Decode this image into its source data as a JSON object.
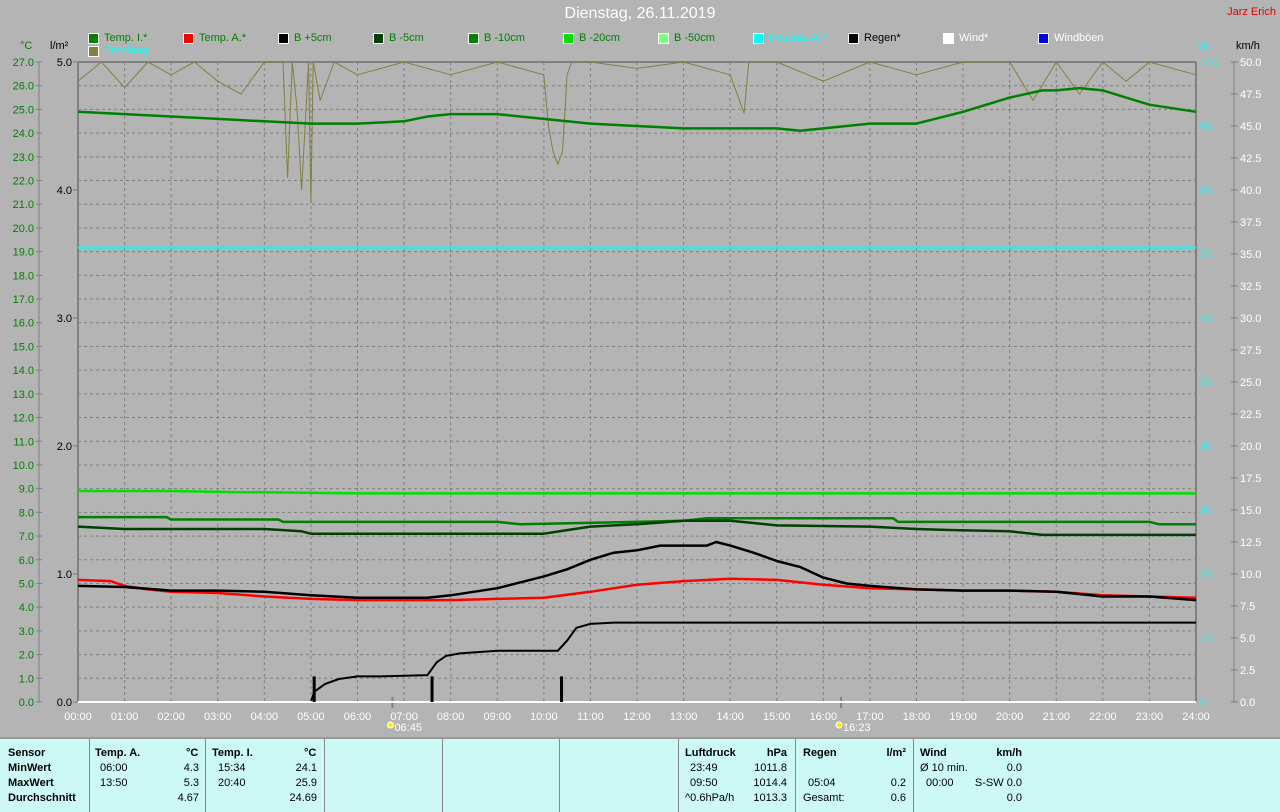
{
  "header": {
    "title": "Dienstag, 26.11.2019",
    "author": "Jarz Erich"
  },
  "legend": [
    {
      "label": "Temp. I.*",
      "color": "#008000",
      "text_color": "#008000"
    },
    {
      "label": "Temp. A.*",
      "color": "#ff0000",
      "text_color": "#008000"
    },
    {
      "label": "B +5cm",
      "color": "#000000",
      "text_color": "#008000"
    },
    {
      "label": "B -5cm",
      "color": "#004000",
      "text_color": "#008000"
    },
    {
      "label": "B -10cm",
      "color": "#008000",
      "text_color": "#008000"
    },
    {
      "label": "B -20cm",
      "color": "#00e000",
      "text_color": "#008000"
    },
    {
      "label": "B -50cm",
      "color": "#80ff80",
      "text_color": "#008000"
    },
    {
      "label": "Feuchte A.*",
      "color": "#00ffff",
      "text_color": "#00ffff"
    },
    {
      "label": "Regen*",
      "color": "#000000",
      "text_color": "#000000"
    },
    {
      "label": "Wind*",
      "color": "#ffffff",
      "text_color": "#ffffff"
    },
    {
      "label": "Windböen",
      "color": "#0000ff",
      "text_color": "#ffffff"
    },
    {
      "label": "Empfang",
      "color": "#808040",
      "text_color": "#00ffff"
    }
  ],
  "chart_data": {
    "type": "line",
    "title": "Dienstag, 26.11.2019",
    "x_unit": "hour",
    "xlim": [
      0,
      24
    ],
    "x_ticks": [
      "00:00",
      "01:00",
      "02:00",
      "03:00",
      "04:00",
      "05:00",
      "06:00",
      "07:00",
      "08:00",
      "09:00",
      "10:00",
      "11:00",
      "12:00",
      "13:00",
      "14:00",
      "15:00",
      "16:00",
      "17:00",
      "18:00",
      "19:00",
      "20:00",
      "21:00",
      "22:00",
      "23:00",
      "24:00"
    ],
    "axes": {
      "temp": {
        "label": "°C",
        "ylim": [
          0,
          27
        ],
        "ticks": [
          "0.0",
          "1.0",
          "2.0",
          "3.0",
          "4.0",
          "5.0",
          "6.0",
          "7.0",
          "8.0",
          "9.0",
          "10.0",
          "11.0",
          "12.0",
          "13.0",
          "14.0",
          "15.0",
          "16.0",
          "17.0",
          "18.0",
          "19.0",
          "20.0",
          "21.0",
          "22.0",
          "23.0",
          "24.0",
          "25.0",
          "26.0",
          "27.0"
        ]
      },
      "rain": {
        "label": "l/m²",
        "ylim": [
          0,
          5
        ],
        "ticks": [
          "0.0",
          "1.0",
          "2.0",
          "3.0",
          "4.0",
          "5.0"
        ]
      },
      "humidity": {
        "label": "%",
        "ylim": [
          0,
          100
        ],
        "ticks": [
          "0",
          "10",
          "20",
          "30",
          "40",
          "50",
          "60",
          "70",
          "80",
          "90",
          "100"
        ]
      },
      "wind": {
        "label": "km/h",
        "ylim": [
          0,
          50
        ],
        "ticks": [
          "0.0",
          "2.5",
          "5.0",
          "7.5",
          "10.0",
          "12.5",
          "15.0",
          "17.5",
          "20.0",
          "22.5",
          "25.0",
          "27.5",
          "30.0",
          "32.5",
          "35.0",
          "37.5",
          "40.0",
          "42.5",
          "45.0",
          "47.5",
          "50.0"
        ]
      }
    },
    "sun": {
      "sunrise": "06:45",
      "sunset": "16:23",
      "sunrise_h": 6.75,
      "sunset_h": 16.38
    },
    "series": [
      {
        "name": "Temp. I.",
        "axis": "temp",
        "color": "#008000",
        "x": [
          0,
          1,
          2,
          3,
          4,
          5,
          6,
          7,
          7.5,
          8,
          9,
          10,
          11,
          12,
          13,
          14,
          15,
          15.5,
          16,
          17,
          18,
          19,
          20,
          20.7,
          21,
          21.5,
          22,
          23,
          24
        ],
        "y": [
          24.9,
          24.8,
          24.7,
          24.6,
          24.5,
          24.4,
          24.4,
          24.5,
          24.7,
          24.8,
          24.8,
          24.6,
          24.4,
          24.3,
          24.2,
          24.2,
          24.2,
          24.1,
          24.2,
          24.4,
          24.4,
          24.9,
          25.5,
          25.8,
          25.8,
          25.9,
          25.8,
          25.2,
          24.9
        ]
      },
      {
        "name": "Temp. A.",
        "axis": "temp",
        "color": "#ff0000",
        "x": [
          0,
          0.7,
          1,
          1.5,
          2,
          3,
          4,
          5,
          6,
          7,
          8,
          9,
          10,
          11,
          12,
          13,
          14,
          15,
          16,
          17,
          18,
          19,
          20,
          21,
          22,
          23,
          24
        ],
        "y": [
          5.15,
          5.1,
          4.9,
          4.75,
          4.65,
          4.6,
          4.45,
          4.35,
          4.3,
          4.3,
          4.3,
          4.35,
          4.4,
          4.65,
          4.95,
          5.1,
          5.2,
          5.15,
          4.95,
          4.8,
          4.75,
          4.7,
          4.7,
          4.65,
          4.5,
          4.45,
          4.4
        ]
      },
      {
        "name": "B +5cm",
        "axis": "temp",
        "color": "#000000",
        "x": [
          0,
          1,
          2,
          3,
          4,
          5,
          6,
          7,
          7.5,
          8,
          9,
          10,
          10.5,
          11,
          11.5,
          12,
          12.5,
          13,
          13.5,
          13.7,
          14,
          14.5,
          15,
          15.5,
          16,
          16.5,
          17,
          18,
          19,
          20,
          21,
          22,
          23,
          24
        ],
        "y": [
          4.9,
          4.85,
          4.7,
          4.7,
          4.65,
          4.5,
          4.4,
          4.4,
          4.4,
          4.5,
          4.8,
          5.3,
          5.6,
          6.0,
          6.3,
          6.4,
          6.6,
          6.6,
          6.6,
          6.75,
          6.6,
          6.3,
          5.95,
          5.7,
          5.25,
          5.0,
          4.9,
          4.75,
          4.7,
          4.7,
          4.65,
          4.45,
          4.45,
          4.3
        ]
      },
      {
        "name": "B -5cm",
        "axis": "temp",
        "color": "#004000",
        "x": [
          0,
          1,
          4,
          4.8,
          5,
          10,
          10.5,
          11,
          12,
          13,
          14,
          14.5,
          15,
          17,
          18,
          18.8,
          20,
          20.7,
          24
        ],
        "y": [
          7.4,
          7.3,
          7.3,
          7.2,
          7.1,
          7.1,
          7.25,
          7.4,
          7.5,
          7.65,
          7.65,
          7.55,
          7.45,
          7.4,
          7.3,
          7.25,
          7.2,
          7.05,
          7.05
        ]
      },
      {
        "name": "B -10cm",
        "axis": "temp",
        "color": "#008000",
        "x": [
          0,
          1.9,
          2,
          4.3,
          4.4,
          9,
          9.5,
          12,
          13,
          13.5,
          17.5,
          17.6,
          23,
          23.2,
          24
        ],
        "y": [
          7.8,
          7.8,
          7.7,
          7.7,
          7.6,
          7.6,
          7.5,
          7.6,
          7.65,
          7.75,
          7.75,
          7.6,
          7.6,
          7.5,
          7.5
        ]
      },
      {
        "name": "B -20cm",
        "axis": "temp",
        "color": "#00e000",
        "x": [
          0,
          2,
          3.5,
          4,
          6,
          7,
          24
        ],
        "y": [
          8.9,
          8.9,
          8.85,
          8.85,
          8.8,
          8.8,
          8.8
        ]
      },
      {
        "name": "B -50cm",
        "axis": "temp",
        "color": "#80ff80",
        "x": [
          0,
          24
        ],
        "y": [
          0,
          0
        ]
      },
      {
        "name": "Feuchte A.",
        "axis": "humidity",
        "color": "#00ffff",
        "x": [
          0,
          24
        ],
        "y": [
          71,
          71
        ]
      },
      {
        "name": "Regen",
        "axis": "rain",
        "color": "#000000",
        "x": [
          0,
          5.0,
          5.07,
          5.3,
          5.6,
          6,
          6.5,
          7.5,
          7.7,
          7.9,
          8.2,
          9,
          10.3,
          10.5,
          10.7,
          11,
          11.5,
          24
        ],
        "y": [
          0,
          0,
          0.08,
          0.14,
          0.18,
          0.2,
          0.2,
          0.21,
          0.31,
          0.36,
          0.38,
          0.4,
          0.4,
          0.48,
          0.58,
          0.61,
          0.62,
          0.62
        ]
      },
      {
        "name": "Empfang",
        "axis": "humidity",
        "color": "#808040",
        "x": [
          0,
          0.5,
          1,
          1.5,
          2,
          2.5,
          3,
          3.5,
          4,
          4.4,
          4.5,
          4.6,
          4.7,
          4.8,
          4.95,
          5.0,
          5.05,
          5.2,
          5.5,
          6,
          7,
          8,
          9,
          10,
          10.1,
          10.2,
          10.3,
          10.4,
          10.5,
          10.6,
          11,
          12,
          13,
          14,
          14.3,
          14.4,
          15,
          16,
          17,
          18,
          19,
          20,
          20.5,
          21,
          21.5,
          22,
          22.5,
          23,
          24
        ],
        "y": [
          97,
          100,
          96,
          100,
          98,
          100,
          97,
          95,
          100,
          100,
          82,
          100,
          93,
          80,
          100,
          78,
          100,
          94,
          100,
          98,
          100,
          98,
          100,
          98,
          90,
          86,
          84,
          86,
          98,
          100,
          100,
          99,
          100,
          98,
          92,
          100,
          100,
          97,
          100,
          98,
          100,
          100,
          94,
          100,
          95,
          100,
          97,
          100,
          98
        ]
      },
      {
        "name": "Wind",
        "axis": "wind",
        "color": "#ffffff",
        "x": [
          0,
          24
        ],
        "y": [
          0,
          0
        ]
      }
    ],
    "rain_events": [
      {
        "x": 5.07,
        "y": 0.2
      },
      {
        "x": 7.6,
        "y": 0.2
      },
      {
        "x": 10.38,
        "y": 0.2
      }
    ]
  },
  "table": {
    "sensor": {
      "header": "Sensor",
      "min": "MinWert",
      "max": "MaxWert",
      "avg": "Durchschnitt"
    },
    "temp_a": {
      "header": "Temp. A.",
      "unit": "°C",
      "min_time": "06:00",
      "min": "4.3",
      "max_time": "13:50",
      "max": "5.3",
      "avg": "4.67"
    },
    "temp_i": {
      "header": "Temp. I.",
      "unit": "°C",
      "min_time": "15:34",
      "min": "24.1",
      "max_time": "20:40",
      "max": "25.9",
      "avg": "24.69"
    },
    "pressure": {
      "header": "Luftdruck",
      "unit": "hPa",
      "min_time": "23:49",
      "min": "1011.8",
      "max_time": "09:50",
      "max": "1014.4",
      "trend": "^0.6hPa/h",
      "current": "1013.3"
    },
    "rain": {
      "header": "Regen",
      "unit": "l/m²",
      "max_time": "05:04",
      "max": "0.2",
      "total_label": "Gesamt:",
      "total": "0.6"
    },
    "wind": {
      "header": "Wind",
      "unit": "km/h",
      "avg_label": "Ø 10 min.",
      "avg": "0.0",
      "max_time": "00:00",
      "max": "S-SW 0.0",
      "current": "0.0"
    }
  }
}
